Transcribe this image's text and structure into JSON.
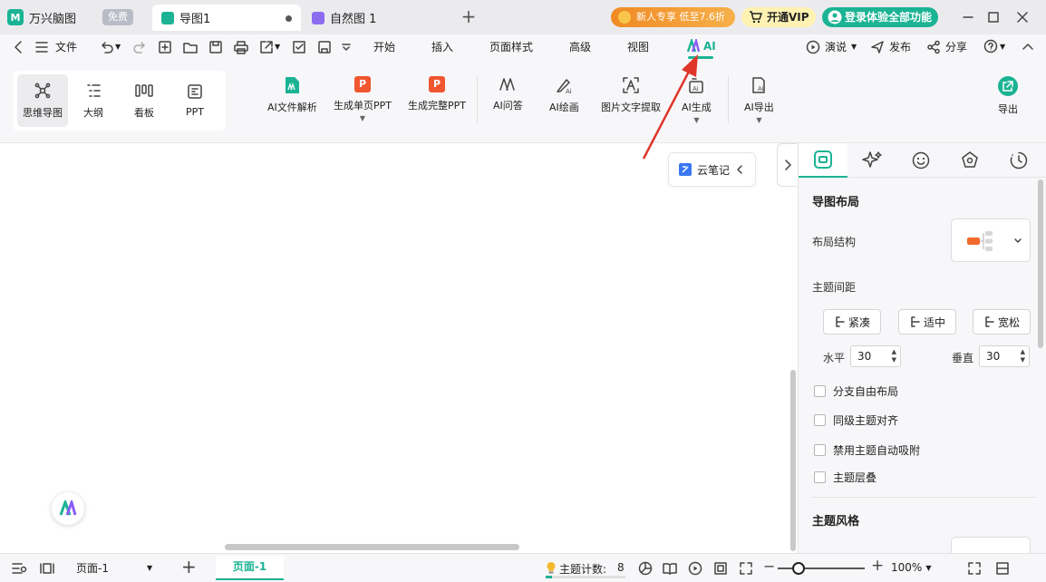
{
  "titlebar": {
    "app_name": "万兴脑图",
    "free_badge": "免费",
    "tabs": [
      {
        "label": "导图1",
        "icon": "mindmap-file-icon",
        "active": true,
        "unsaved": true
      },
      {
        "label": "自然图 1",
        "icon": "natural-map-file-icon",
        "active": false
      }
    ],
    "promo": "新人专享 低至7.6折",
    "vip": "开通VIP",
    "login": "登录体验全部功能"
  },
  "menubar": {
    "file": "文件",
    "menus": [
      "开始",
      "插入",
      "页面样式",
      "高级",
      "视图"
    ],
    "ai": "AI",
    "present": "演说",
    "publish": "发布",
    "share": "分享"
  },
  "ribbon": {
    "views": [
      {
        "label": "思维导图",
        "icon": "mindmap-view-icon",
        "active": true
      },
      {
        "label": "大纲",
        "icon": "outline-view-icon",
        "active": false
      },
      {
        "label": "看板",
        "icon": "kanban-view-icon",
        "active": false
      },
      {
        "label": "PPT",
        "icon": "ppt-view-icon",
        "active": false
      }
    ],
    "ai_tools": [
      {
        "label": "AI文件解析",
        "icon": "ai-file-parse-icon"
      },
      {
        "label": "生成单页PPT",
        "icon": "ppt-single-icon",
        "dropdown": true
      },
      {
        "label": "生成完整PPT",
        "icon": "ppt-full-icon"
      },
      {
        "label": "AI问答",
        "icon": "ai-qa-icon"
      },
      {
        "label": "AI绘画",
        "icon": "ai-paint-icon"
      },
      {
        "label": "图片文字提取",
        "icon": "ocr-icon"
      },
      {
        "label": "AI生成",
        "icon": "ai-generate-icon",
        "dropdown": true
      },
      {
        "label": "AI导出",
        "icon": "ai-export-icon",
        "dropdown": true
      }
    ],
    "export": "导出"
  },
  "canvas": {
    "cloud_note": "云笔记"
  },
  "panel": {
    "tabs": [
      "layout-tab-icon",
      "ai-sparkle-tab-icon",
      "sticker-tab-icon",
      "theme-tab-icon",
      "history-tab-icon"
    ],
    "section_layout": "导图布局",
    "layout_structure": "布局结构",
    "topic_spacing": "主题间距",
    "spacing_options": [
      "紧凑",
      "适中",
      "宽松"
    ],
    "horizontal_label": "水平",
    "horizontal_value": "30",
    "vertical_label": "垂直",
    "vertical_value": "30",
    "options": [
      "分支自由布局",
      "同级主题对齐",
      "禁用主题自动吸附",
      "主题层叠"
    ],
    "section_style": "主题风格"
  },
  "statusbar": {
    "page_select": "页面-1",
    "page_tab": "页面-1",
    "topic_count_label": "主题计数:",
    "topic_count": "8",
    "zoom": "100%"
  },
  "colors": {
    "accent": "#1bb394",
    "ppt_red": "#f0562f",
    "arrow_red": "#e0352b",
    "promo_orange": "#f08a24"
  }
}
